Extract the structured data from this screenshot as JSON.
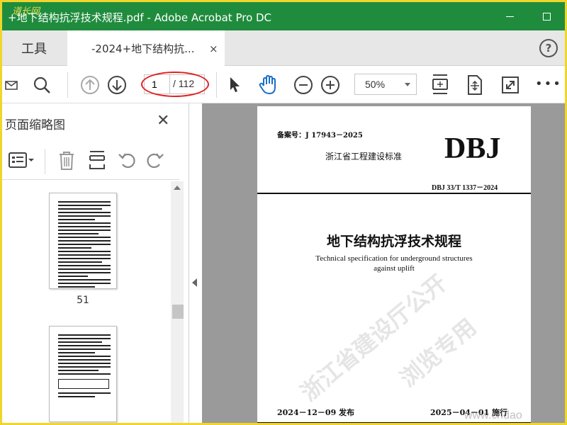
{
  "window": {
    "title": "+地下结构抗浮技术规程.pdf - Adobe Acrobat Pro DC",
    "logo_text": "道长网"
  },
  "tabs": {
    "tools_label": "工具",
    "doc_label": "-2024+地下结构抗...",
    "close_glyph": "×",
    "help_glyph": "?"
  },
  "toolbar": {
    "page_current": "1",
    "page_total": "/ 112",
    "zoom": "50%",
    "more_glyph": "•••"
  },
  "left_panel": {
    "title": "页面缩略图",
    "close_glyph": "✕",
    "thumbnails": [
      {
        "label": "51"
      },
      {
        "label": ""
      }
    ]
  },
  "document": {
    "record_no": "备案号：J 17943－2025",
    "standard_label": "浙江省工程建设标准",
    "dbj": "DBJ",
    "standard_code": "DBJ 33/T 1337－2024",
    "title_cn": "地下结构抗浮技术规程",
    "title_en_line1": "Technical specification for underground structures",
    "title_en_line2": "against uplift",
    "issue_date": "2024－12－09 发布",
    "impl_date": "2025－04－01 施行",
    "watermark_line1": "浙江省建设厅公开",
    "watermark_line2": "浏览专用",
    "site_watermark": "www.cndao"
  },
  "colors": {
    "titlebar": "#1f8c3d",
    "border": "#f0d62a",
    "highlight": "#e02020",
    "hand_tool": "#1a6fc9"
  }
}
